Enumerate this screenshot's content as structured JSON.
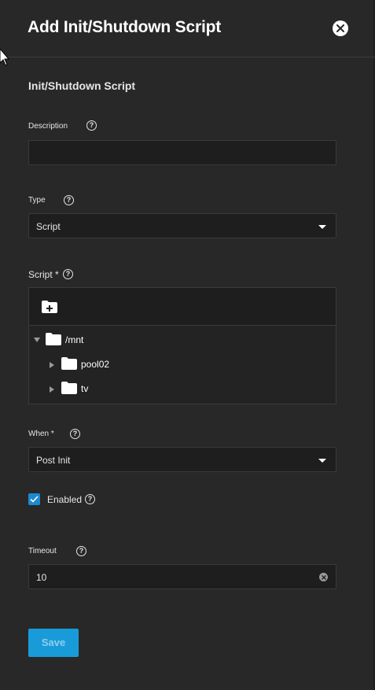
{
  "header": {
    "title": "Add Init/Shutdown Script"
  },
  "section": {
    "title": "Init/Shutdown Script"
  },
  "description": {
    "label": "Description",
    "value": ""
  },
  "type": {
    "label": "Type",
    "value": "Script"
  },
  "script": {
    "label": "Script *",
    "tree": [
      {
        "label": "/mnt",
        "expanded": true
      },
      {
        "label": "pool02",
        "expanded": false
      },
      {
        "label": "tv",
        "expanded": false
      }
    ]
  },
  "when": {
    "label": "When *",
    "value": "Post Init"
  },
  "enabled": {
    "label": "Enabled",
    "checked": true
  },
  "timeout": {
    "label": "Timeout",
    "value": "10"
  },
  "actions": {
    "save_label": "Save"
  },
  "colors": {
    "accent": "#1a9bd9",
    "background": "#282828",
    "field": "#1e1e1e"
  }
}
